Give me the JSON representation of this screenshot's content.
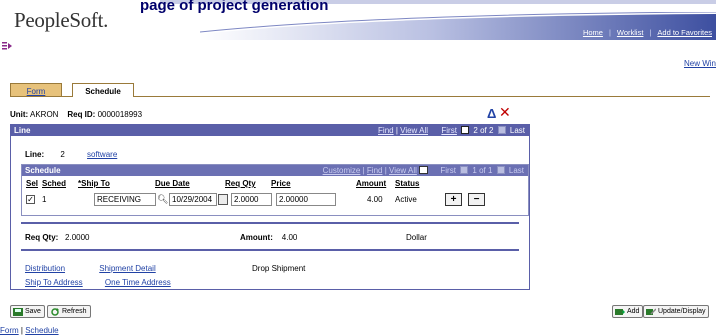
{
  "page_heading": "page of project generation",
  "brand": {
    "logo_text": "PeopleSoft."
  },
  "top_links": [
    "Home",
    "Worklist",
    "Add to Favorites"
  ],
  "new_window_link": "New Win",
  "tabs": [
    {
      "label": "Form",
      "active": false
    },
    {
      "label": "Schedule",
      "active": true
    }
  ],
  "header": {
    "unit_label": "Unit:",
    "unit_value": "AKRON",
    "reqid_label": "Req ID:",
    "reqid_value": "0000018993"
  },
  "line_grid": {
    "title": "Line",
    "find_label": "Find",
    "view_all_label": "View All",
    "first_label": "First",
    "range": "2 of 2",
    "last_label": "Last",
    "line_label": "Line:",
    "line_value": "2",
    "line_desc": "software"
  },
  "schedule_grid": {
    "title": "Schedule",
    "customize_label": "Customize",
    "find_label": "Find",
    "view_all_label": "View All",
    "first_label": "First",
    "range": "1 of 1",
    "last_label": "Last",
    "columns": [
      "Sel",
      "Sched",
      "*Ship To",
      "Due Date",
      "Req Qty",
      "Price",
      "Amount",
      "Status"
    ],
    "row": {
      "sel_checked": true,
      "sel_mark": "✓",
      "sched": "1",
      "ship_to": "RECEIVING",
      "due_date": "10/29/2004",
      "req_qty": "2.0000",
      "price": "2.00000",
      "amount": "4.00",
      "status": "Active"
    },
    "add_symbol": "+",
    "delete_symbol": "−"
  },
  "totals": {
    "req_qty_label": "Req Qty:",
    "req_qty_value": "2.0000",
    "amount_label": "Amount:",
    "amount_value": "4.00",
    "currency": "Dollar"
  },
  "links": {
    "distribution": "Distribution",
    "shipment_detail": "Shipment Detail",
    "drop_shipment": "Drop Shipment",
    "ship_to_address": "Ship To Address",
    "one_time_address": "One Time Address"
  },
  "toolbar": {
    "save_label": "Save",
    "refresh_label": "Refresh",
    "add_label": "Add",
    "update_label": "Update/Display"
  },
  "footer": {
    "form_link": "Form",
    "separator": "|",
    "schedule_link": "Schedule"
  },
  "colors": {
    "grid_header": "#5a5fa8",
    "link": "#2142a5",
    "tab_inactive": "#e7c27b",
    "delete_red": "#c00000"
  }
}
